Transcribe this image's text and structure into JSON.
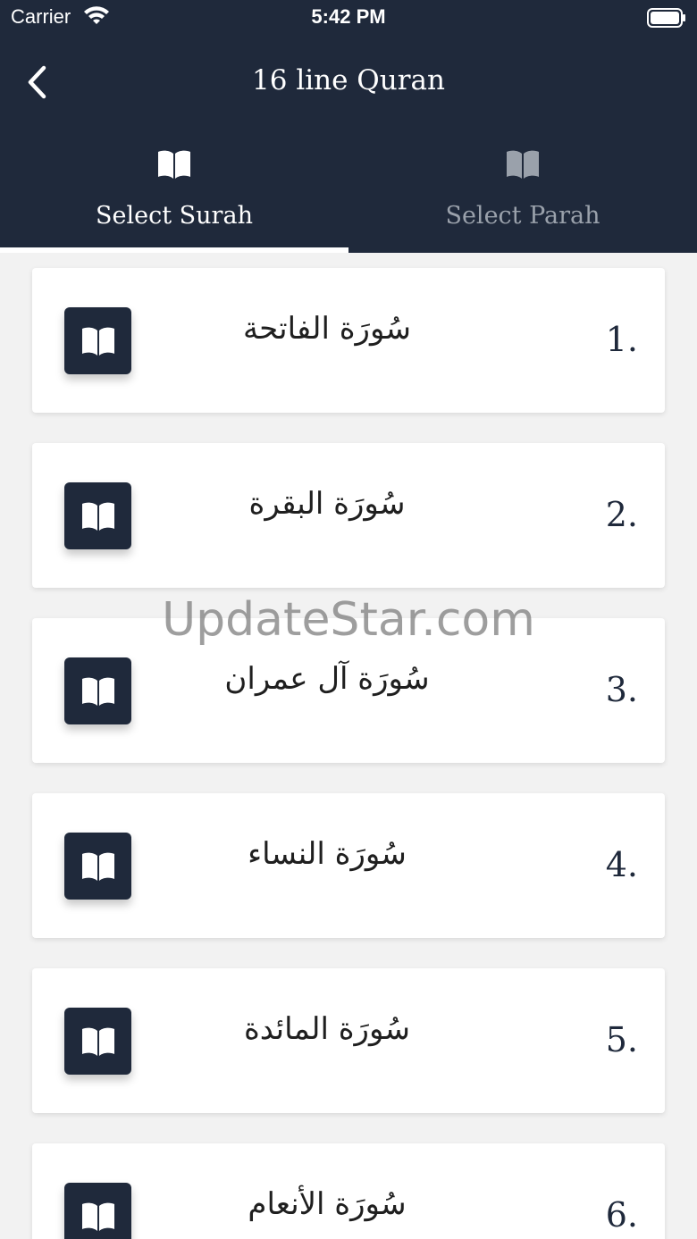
{
  "status_bar": {
    "carrier": "Carrier",
    "time": "5:42 PM",
    "wifi_icon": "wifi-icon",
    "battery_icon": "battery-icon"
  },
  "nav": {
    "title": "16 line Quran",
    "back_icon": "chevron-left-icon"
  },
  "tabs": [
    {
      "label": "Select Surah",
      "icon": "book-open-icon",
      "active": true
    },
    {
      "label": "Select Parah",
      "icon": "book-open-icon",
      "active": false
    }
  ],
  "surahs": [
    {
      "number": "1.",
      "name": "سُورَة الفاتحة"
    },
    {
      "number": "2.",
      "name": "سُورَة البقرة"
    },
    {
      "number": "3.",
      "name": "سُورَة آل عمران"
    },
    {
      "number": "4.",
      "name": "سُورَة النساء"
    },
    {
      "number": "5.",
      "name": "سُورَة المائدة"
    },
    {
      "number": "6.",
      "name": "سُورَة الأنعام"
    }
  ],
  "watermark": "UpdateStar.com",
  "colors": {
    "header_bg": "#1f293b",
    "active_tab": "#ffffff",
    "inactive_tab": "#9aa1ab",
    "list_bg": "#f2f2f2",
    "card_bg": "#ffffff",
    "icon_button": "#1f293b"
  }
}
